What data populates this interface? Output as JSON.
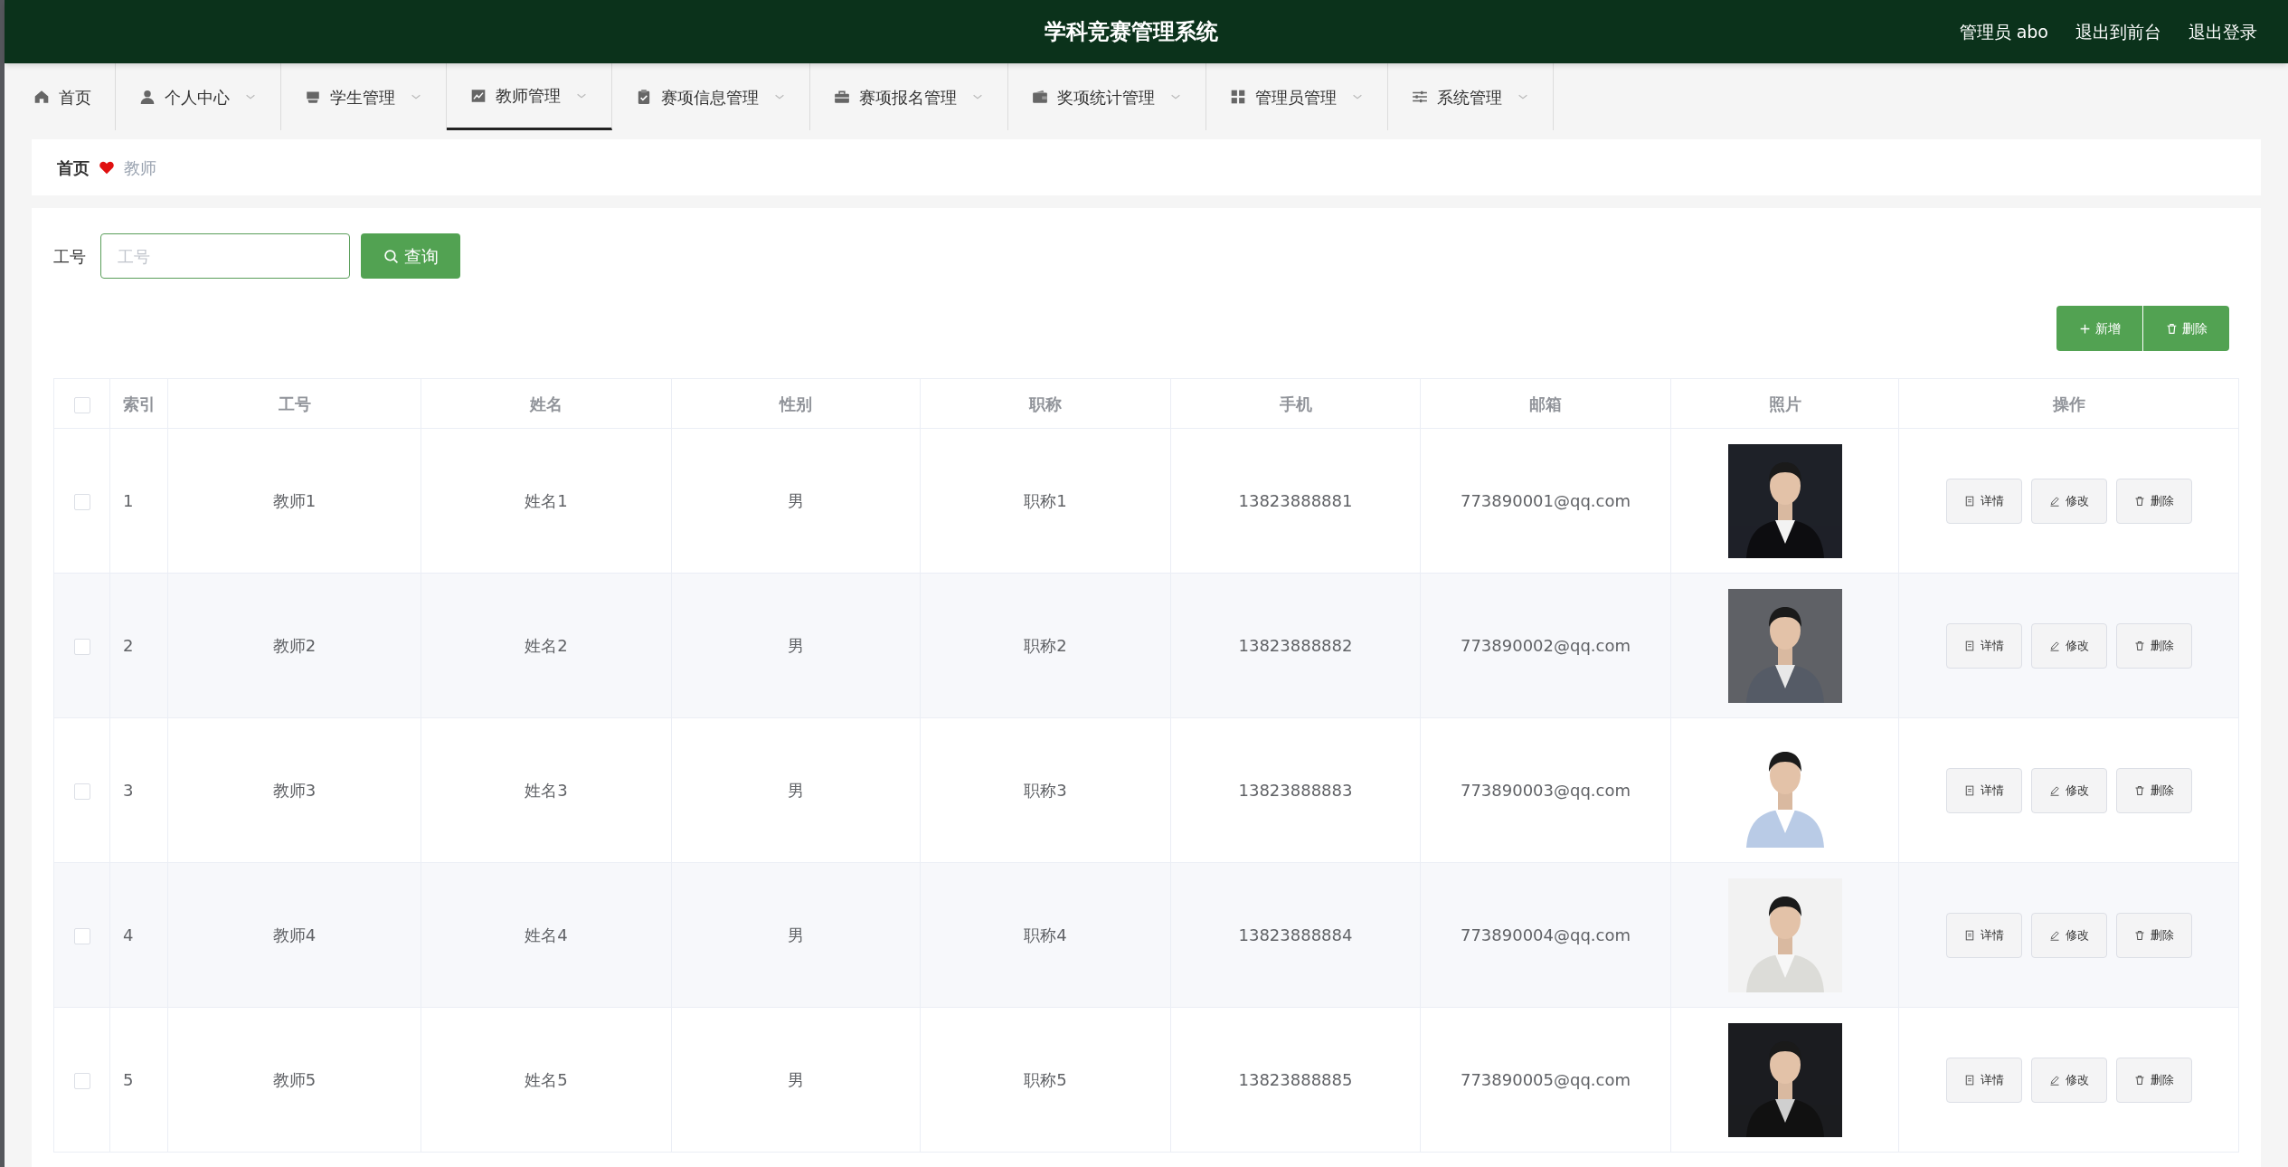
{
  "header": {
    "title": "学科竞赛管理系统",
    "user": "管理员 abo",
    "links": [
      "退出到前台",
      "退出登录"
    ]
  },
  "nav": [
    {
      "label": "首页",
      "selected": false,
      "dropdown": false
    },
    {
      "label": "个人中心",
      "selected": false,
      "dropdown": true
    },
    {
      "label": "学生管理",
      "selected": false,
      "dropdown": true
    },
    {
      "label": "教师管理",
      "selected": true,
      "dropdown": true
    },
    {
      "label": "赛项信息管理",
      "selected": false,
      "dropdown": true
    },
    {
      "label": "赛项报名管理",
      "selected": false,
      "dropdown": true
    },
    {
      "label": "奖项统计管理",
      "selected": false,
      "dropdown": true
    },
    {
      "label": "管理员管理",
      "selected": false,
      "dropdown": true
    },
    {
      "label": "系统管理",
      "selected": false,
      "dropdown": true
    }
  ],
  "breadcrumb": {
    "home": "首页",
    "current": "教师"
  },
  "search": {
    "label": "工号",
    "placeholder": "工号",
    "button": "查询"
  },
  "toolbar": {
    "add": "新增",
    "delete": "删除"
  },
  "table": {
    "all_checked": false,
    "columns": [
      "索引",
      "工号",
      "姓名",
      "性别",
      "职称",
      "手机",
      "邮箱",
      "照片",
      "操作"
    ],
    "rows": [
      {
        "checked": false,
        "index": "1",
        "id": "教师1",
        "name": "姓名1",
        "gender": "男",
        "title": "职称1",
        "phone": "13823888881",
        "email": "773890001@qq.com",
        "actions": [
          "详情",
          "修改",
          "删除"
        ]
      },
      {
        "checked": false,
        "index": "2",
        "id": "教师2",
        "name": "姓名2",
        "gender": "男",
        "title": "职称2",
        "phone": "13823888882",
        "email": "773890002@qq.com",
        "actions": [
          "详情",
          "修改",
          "删除"
        ]
      },
      {
        "checked": false,
        "index": "3",
        "id": "教师3",
        "name": "姓名3",
        "gender": "男",
        "title": "职称3",
        "phone": "13823888883",
        "email": "773890003@qq.com",
        "actions": [
          "详情",
          "修改",
          "删除"
        ]
      },
      {
        "checked": false,
        "index": "4",
        "id": "教师4",
        "name": "姓名4",
        "gender": "男",
        "title": "职称4",
        "phone": "13823888884",
        "email": "773890004@qq.com",
        "actions": [
          "详情",
          "修改",
          "删除"
        ]
      },
      {
        "checked": false,
        "index": "5",
        "id": "教师5",
        "name": "姓名5",
        "gender": "男",
        "title": "职称5",
        "phone": "13823888885",
        "email": "773890005@qq.com",
        "actions": [
          "详情",
          "修改",
          "删除"
        ]
      }
    ]
  }
}
